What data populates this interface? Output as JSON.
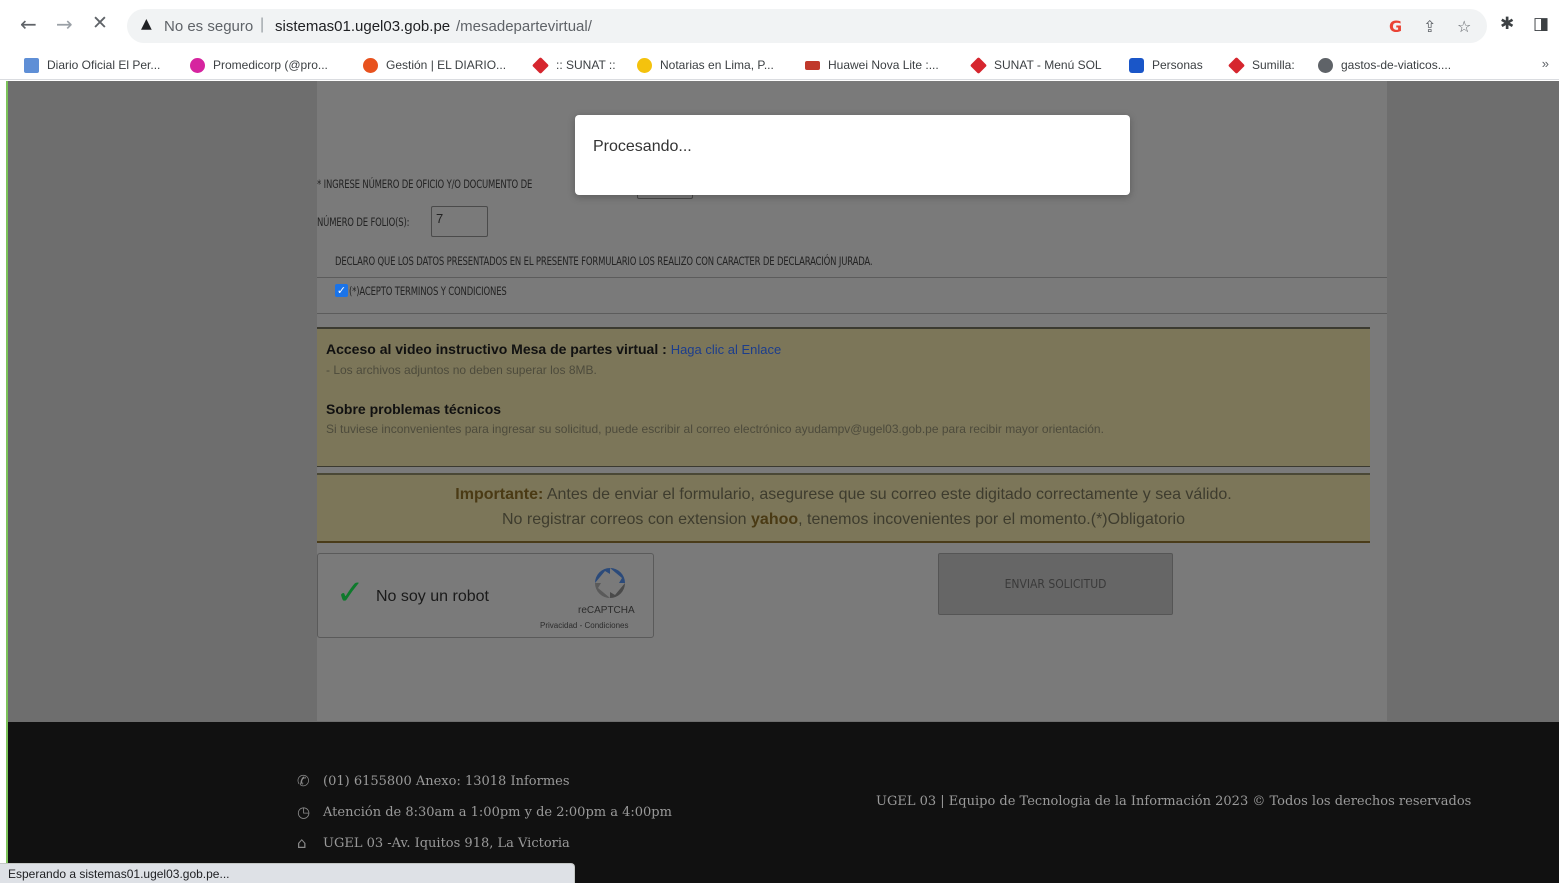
{
  "browser": {
    "nav": {
      "back": "←",
      "forward": "→",
      "stop": "✕"
    },
    "omnibox": {
      "warning_icon": "warning-triangle-icon",
      "security_label": "No es seguro",
      "separator": "|",
      "host": "sistemas01.ugel03.gob.pe",
      "path": "/mesadepartevirtual/"
    },
    "bookmarks": [
      {
        "label": "Diario Oficial El Per...",
        "icon": "page-icon",
        "color": "#5f8fd6"
      },
      {
        "label": "Promedicorp (@pro...",
        "icon": "instagram-icon",
        "color": "#d6249f"
      },
      {
        "label": "Gestión | EL DIARIO...",
        "icon": "gestion-icon",
        "color": "#e8521e"
      },
      {
        "label": ":: SUNAT ::",
        "icon": "sunat-icon",
        "color": "#d6262e"
      },
      {
        "label": "Notarias en Lima, P...",
        "icon": "notarias-icon",
        "color": "#f4c20d"
      },
      {
        "label": "Huawei Nova Lite :...",
        "icon": "gsm-icon",
        "color": "#c0392b"
      },
      {
        "label": "SUNAT - Menú SOL",
        "icon": "sunat-icon",
        "color": "#d6262e"
      },
      {
        "label": "Personas",
        "icon": "personas-icon",
        "color": "#1a56c8"
      },
      {
        "label": "Sumilla:",
        "icon": "sunat-icon",
        "color": "#d6262e"
      },
      {
        "label": "gastos-de-viaticos....",
        "icon": "globe-icon",
        "color": "#5f6368"
      }
    ],
    "bookmarks_more": "»",
    "status": "Esperando a sistemas01.ugel03.gob.pe..."
  },
  "form": {
    "doc_label": "* Ingrese número de oficio y/o documento de",
    "folio_label": "Número de folio(s):",
    "folio_value": "7",
    "declaration": "Declaro que los datos presentados en el presente formulario los realizo con caracter de declaración jurada.",
    "accept_label": "(*)Acepto terminos y condiciones",
    "accept_checked": true
  },
  "info": {
    "video_heading": "Acceso al video instructivo Mesa de partes virtual :",
    "video_link": "Haga clic al Enlace",
    "files_note": "- Los archivos adjuntos no deben superar los 8MB.",
    "tech_heading": "Sobre problemas técnicos",
    "tech_note": "Si tuviese inconvenientes para ingresar su solicitud, puede escribir al correo electrónico ayudampv@ugel03.gob.pe para recibir mayor orientación."
  },
  "important": {
    "label": "Importante:",
    "line1": "Antes de enviar el formulario, asegurese que su correo este digitado correctamente y sea válido.",
    "line2_pre": "No registrar correos con extension",
    "line2_strong": "yahoo",
    "line2_post": ", tenemos incovenientes por el momento.(*)Obligatorio"
  },
  "recaptcha": {
    "label": "No soy un robot",
    "brand": "reCAPTCHA",
    "links": "Privacidad - Condiciones",
    "checked": true
  },
  "send_button": "Enviar solicitud",
  "footer": {
    "phone": "(01) 6155800 Anexo: 13018 Informes",
    "hours": "Atención de 8:30am a 1:00pm y de 2:00pm a 4:00pm",
    "address": "UGEL 03 -Av. Iquitos 918, La Victoria",
    "copyright": "UGEL 03 | Equipo de Tecnologia de la Información 2023 © Todos los derechos reservados"
  },
  "modal": {
    "text": "Procesando..."
  }
}
